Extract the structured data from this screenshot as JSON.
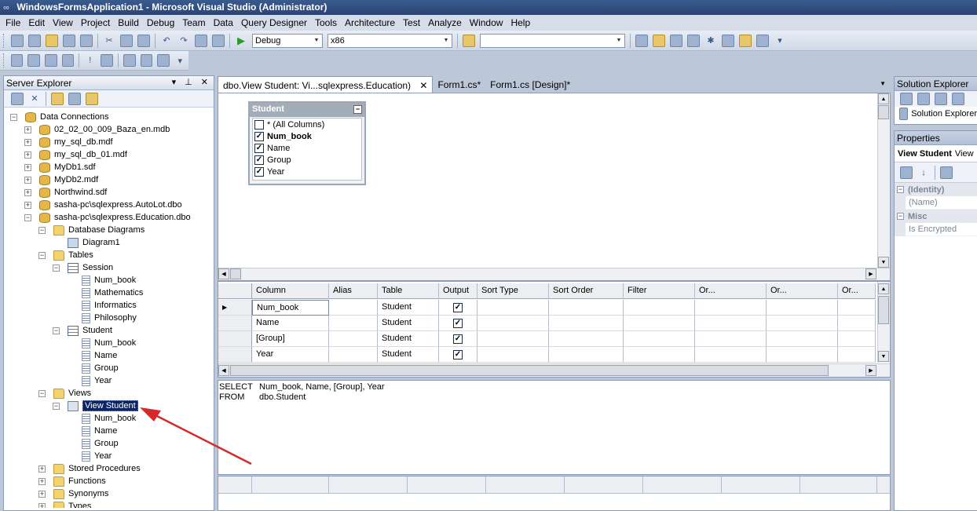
{
  "window": {
    "title": "WindowsFormsApplication1 - Microsoft Visual Studio (Administrator)"
  },
  "menu": [
    "File",
    "Edit",
    "View",
    "Project",
    "Build",
    "Debug",
    "Team",
    "Data",
    "Query Designer",
    "Tools",
    "Architecture",
    "Test",
    "Analyze",
    "Window",
    "Help"
  ],
  "toolbar": {
    "configuration": "Debug",
    "platform": "x86",
    "find_value": ""
  },
  "server_explorer": {
    "title": "Server Explorer",
    "header_buttons": "▾ ⊥ ✕",
    "tree": [
      {
        "label": "Data Connections",
        "level": 0,
        "expander": "−",
        "icon": "folder-db-icon"
      },
      {
        "label": "02_02_00_009_Baza_en.mdb",
        "level": 1,
        "expander": "+",
        "icon": "database-icon"
      },
      {
        "label": "my_sql_db.mdf",
        "level": 1,
        "expander": "+",
        "icon": "database-icon"
      },
      {
        "label": "my_sql_db_01.mdf",
        "level": 1,
        "expander": "+",
        "icon": "database-icon"
      },
      {
        "label": "MyDb1.sdf",
        "level": 1,
        "expander": "+",
        "icon": "database-icon"
      },
      {
        "label": "MyDb2.mdf",
        "level": 1,
        "expander": "+",
        "icon": "database-icon"
      },
      {
        "label": "Northwind.sdf",
        "level": 1,
        "expander": "+",
        "icon": "database-icon"
      },
      {
        "label": "sasha-pc\\sqlexpress.AutoLot.dbo",
        "level": 1,
        "expander": "+",
        "icon": "database-icon"
      },
      {
        "label": "sasha-pc\\sqlexpress.Education.dbo",
        "level": 1,
        "expander": "−",
        "icon": "database-icon"
      },
      {
        "label": "Database Diagrams",
        "level": 2,
        "expander": "−",
        "icon": "folder-icon"
      },
      {
        "label": "Diagram1",
        "level": 3,
        "expander": "",
        "icon": "diagram-icon"
      },
      {
        "label": "Tables",
        "level": 2,
        "expander": "−",
        "icon": "folder-icon"
      },
      {
        "label": "Session",
        "level": 3,
        "expander": "−",
        "icon": "table-icon"
      },
      {
        "label": "Num_book",
        "level": 4,
        "expander": "",
        "icon": "column-icon"
      },
      {
        "label": "Mathematics",
        "level": 4,
        "expander": "",
        "icon": "column-icon"
      },
      {
        "label": "Informatics",
        "level": 4,
        "expander": "",
        "icon": "column-icon"
      },
      {
        "label": "Philosophy",
        "level": 4,
        "expander": "",
        "icon": "column-icon"
      },
      {
        "label": "Student",
        "level": 3,
        "expander": "−",
        "icon": "table-icon"
      },
      {
        "label": "Num_book",
        "level": 4,
        "expander": "",
        "icon": "column-icon"
      },
      {
        "label": "Name",
        "level": 4,
        "expander": "",
        "icon": "column-icon"
      },
      {
        "label": "Group",
        "level": 4,
        "expander": "",
        "icon": "column-icon"
      },
      {
        "label": "Year",
        "level": 4,
        "expander": "",
        "icon": "column-icon"
      },
      {
        "label": "Views",
        "level": 2,
        "expander": "−",
        "icon": "folder-icon"
      },
      {
        "label": "View Student",
        "level": 3,
        "expander": "−",
        "icon": "view-icon",
        "selected": true
      },
      {
        "label": "Num_book",
        "level": 4,
        "expander": "",
        "icon": "column-icon"
      },
      {
        "label": "Name",
        "level": 4,
        "expander": "",
        "icon": "column-icon"
      },
      {
        "label": "Group",
        "level": 4,
        "expander": "",
        "icon": "column-icon"
      },
      {
        "label": "Year",
        "level": 4,
        "expander": "",
        "icon": "column-icon"
      },
      {
        "label": "Stored Procedures",
        "level": 2,
        "expander": "+",
        "icon": "folder-icon"
      },
      {
        "label": "Functions",
        "level": 2,
        "expander": "+",
        "icon": "folder-icon"
      },
      {
        "label": "Synonyms",
        "level": 2,
        "expander": "+",
        "icon": "folder-icon"
      },
      {
        "label": "Types",
        "level": 2,
        "expander": "+",
        "icon": "folder-icon"
      }
    ]
  },
  "doc_tabs": [
    {
      "label": "dbo.View Student: Vi...sqlexpress.Education)",
      "active": true
    },
    {
      "label": "Form1.cs*",
      "active": false
    },
    {
      "label": "Form1.cs [Design]*",
      "active": false
    }
  ],
  "diagram": {
    "table_name": "Student",
    "columns": [
      {
        "label": "* (All Columns)",
        "checked": false,
        "bold": false
      },
      {
        "label": "Num_book",
        "checked": true,
        "bold": true
      },
      {
        "label": "Name",
        "checked": true,
        "bold": false
      },
      {
        "label": "Group",
        "checked": true,
        "bold": false
      },
      {
        "label": "Year",
        "checked": true,
        "bold": false
      }
    ]
  },
  "grid": {
    "headers": [
      "Column",
      "Alias",
      "Table",
      "Output",
      "Sort Type",
      "Sort Order",
      "Filter",
      "Or...",
      "Or...",
      "Or..."
    ],
    "rows": [
      {
        "column": "Num_book",
        "alias": "",
        "table": "Student",
        "output": true,
        "current": true
      },
      {
        "column": "Name",
        "alias": "",
        "table": "Student",
        "output": true,
        "current": false
      },
      {
        "column": "[Group]",
        "alias": "",
        "table": "Student",
        "output": true,
        "current": false
      },
      {
        "column": "Year",
        "alias": "",
        "table": "Student",
        "output": true,
        "current": false
      }
    ]
  },
  "sql": {
    "select_kw": "SELECT",
    "select_list": "Num_book, Name, [Group], Year",
    "from_kw": "FROM",
    "from_source": "dbo.Student"
  },
  "solution_explorer": {
    "title": "Solution Explorer",
    "item": "Solution Explorer"
  },
  "properties": {
    "title": "Properties",
    "object_name": "View Student",
    "object_type": "View",
    "categories": [
      {
        "name": "(Identity)",
        "rows": [
          "(Name)"
        ]
      },
      {
        "name": "Misc",
        "rows": [
          "Is Encrypted"
        ]
      }
    ]
  },
  "colors": {
    "selection": "#0A246A",
    "arrow": "#D42A2A",
    "title_bar": "#2A4474"
  }
}
